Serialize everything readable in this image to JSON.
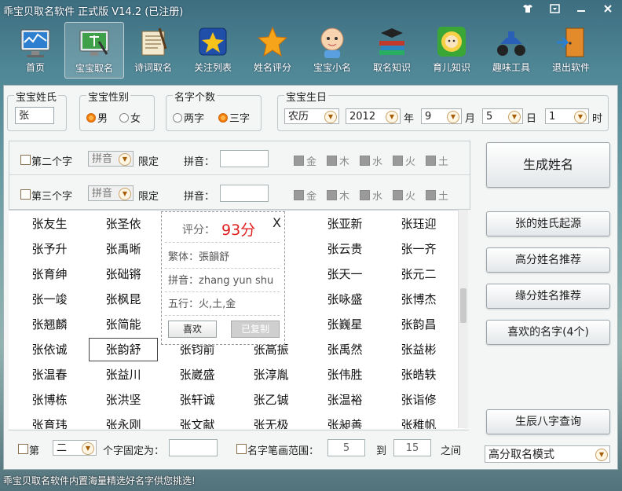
{
  "window": {
    "title": "乖宝贝取名软件  正式版 V14.2  (已注册)",
    "buttons": [
      "skin-icon",
      "restore-icon",
      "minimize-icon",
      "close-icon"
    ]
  },
  "toolbar": {
    "items": [
      {
        "label": "首页",
        "icon": "monitor-chart-icon"
      },
      {
        "label": "宝宝取名",
        "icon": "monitor-pen-icon",
        "active": true
      },
      {
        "label": "诗词取名",
        "icon": "scroll-brush-icon"
      },
      {
        "label": "关注列表",
        "icon": "star-badge-icon"
      },
      {
        "label": "姓名评分",
        "icon": "star-icon"
      },
      {
        "label": "宝宝小名",
        "icon": "baby-face-icon"
      },
      {
        "label": "取名知识",
        "icon": "books-icon"
      },
      {
        "label": "育儿知识",
        "icon": "flower-face-icon"
      },
      {
        "label": "趣味工具",
        "icon": "atv-icon"
      },
      {
        "label": "退出软件",
        "icon": "exit-door-icon"
      }
    ]
  },
  "form": {
    "surname_label": "宝宝姓氏",
    "surname_value": "张",
    "gender_label": "宝宝性别",
    "gender_male": "男",
    "gender_female": "女",
    "count_label": "名字个数",
    "count_two": "两字",
    "count_three": "三字",
    "birthday_label": "宝宝生日",
    "calendar": "农历",
    "year": "2012",
    "year_unit": "年",
    "month": "9",
    "month_unit": "月",
    "day": "5",
    "day_unit": "日",
    "hour": "1",
    "hour_unit": "时"
  },
  "filters": {
    "second_char_label": "第二个字",
    "third_char_label": "第三个字",
    "pinyin_combo": "拼音",
    "limit_label": "限定",
    "pinyin_label": "拼音：",
    "elements": [
      "金",
      "木",
      "水",
      "火",
      "土"
    ]
  },
  "names": [
    [
      "张友生",
      "张圣依",
      "",
      "",
      "张亚新",
      "张珏迎"
    ],
    [
      "张予升",
      "张禹晰",
      "",
      "",
      "张云贵",
      "张一齐"
    ],
    [
      "张育绅",
      "张础锵",
      "",
      "",
      "张天一",
      "张元二"
    ],
    [
      "张一竣",
      "张枫昆",
      "",
      "",
      "张咏盛",
      "张博杰"
    ],
    [
      "张翘麟",
      "张简能",
      "",
      "",
      "张巍星",
      "张韵昌"
    ],
    [
      "张依诚",
      "张韵舒",
      "张钧前",
      "张高振",
      "张禹然",
      "张益彬"
    ],
    [
      "张温春",
      "张益川",
      "张崴盛",
      "张淳胤",
      "张伟胜",
      "张皓轶"
    ],
    [
      "张博栋",
      "张洪坚",
      "张轩诚",
      "张乙铖",
      "张温裕",
      "张诣修"
    ],
    [
      "张育玮",
      "张永刚",
      "张文献",
      "张无极",
      "张昶善",
      "张稚帆"
    ]
  ],
  "popup": {
    "score_label": "评分：",
    "score_value": "93分",
    "close": "X",
    "traditional": "繁体：張韻舒",
    "pinyin": "拼音：zhang yun shu",
    "wuxing": "五行：火,土,金",
    "like_button": "喜欢",
    "copied_button": "已复制"
  },
  "bottom": {
    "nth_label": "第",
    "nth_value": "二",
    "fixed_label": "个字固定为：",
    "stroke_label": "名字笔画范围：",
    "stroke_from": "5",
    "to_label": "到",
    "stroke_to": "15",
    "between_label": "之间"
  },
  "side_buttons": {
    "generate": "生成姓名",
    "origin": "张的姓氏起源",
    "high_score": "高分姓名推荐",
    "fate": "缘分姓名推荐",
    "favorites": "喜欢的名字(4个)",
    "bazi": "生辰八字查询",
    "mode": "高分取名模式"
  },
  "status": "乖宝贝取名软件内置海量精选好名字供您挑选!",
  "colors": {
    "accent": "#f07a0a",
    "score": "#e02020"
  }
}
